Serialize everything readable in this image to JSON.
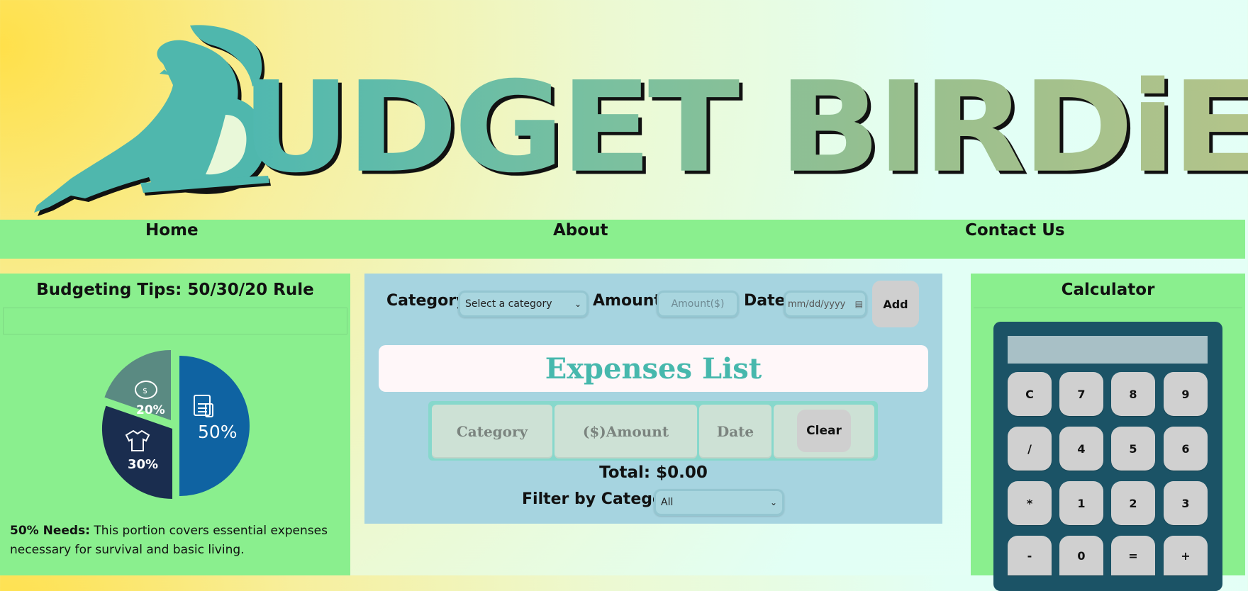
{
  "logo": {
    "word": "UDGET BIRDiE"
  },
  "nav": {
    "items": [
      "Home",
      "About",
      "Contact Us"
    ]
  },
  "tips": {
    "title": "Budgeting Tips: 50/30/20 Rule",
    "pie": [
      {
        "label": "50%",
        "value": 50,
        "icon": "receipt-icon",
        "color": "#0f63a2"
      },
      {
        "label": "30%",
        "value": 30,
        "icon": "shirt-icon",
        "color": "#1a2d4f"
      },
      {
        "label": "20%",
        "value": 20,
        "icon": "piggy-bank-icon",
        "color": "#5a8a82"
      }
    ],
    "needs_label": "50% Needs:",
    "needs_text": " This portion covers essential expenses necessary for survival and basic living."
  },
  "form": {
    "category_label": "Category:",
    "category_value": "Select a category",
    "amount_label": "Amount:",
    "amount_placeholder": "Amount($)",
    "date_label": "Date:",
    "date_placeholder": "mm/dd/yyyy",
    "add_label": "Add"
  },
  "expenses": {
    "title": "Expenses List",
    "columns": [
      "Category",
      "($)Amount",
      "Date"
    ],
    "clear_label": "Clear",
    "total_label": "Total:",
    "total_value": "$0.00",
    "filter_label": "Filter by Category:",
    "filter_value": "All"
  },
  "calculator": {
    "title": "Calculator",
    "display": "",
    "keys": [
      [
        "C",
        "7",
        "8",
        "9"
      ],
      [
        "/",
        "4",
        "5",
        "6"
      ],
      [
        "*",
        "1",
        "2",
        "3"
      ],
      [
        "-",
        "0",
        "=",
        "+"
      ]
    ]
  },
  "colors": {
    "nav_bg": "#8aef8e",
    "center_bg": "#a6d4e0",
    "accent_teal": "#47b8ad",
    "calc_body": "#1b5366"
  }
}
